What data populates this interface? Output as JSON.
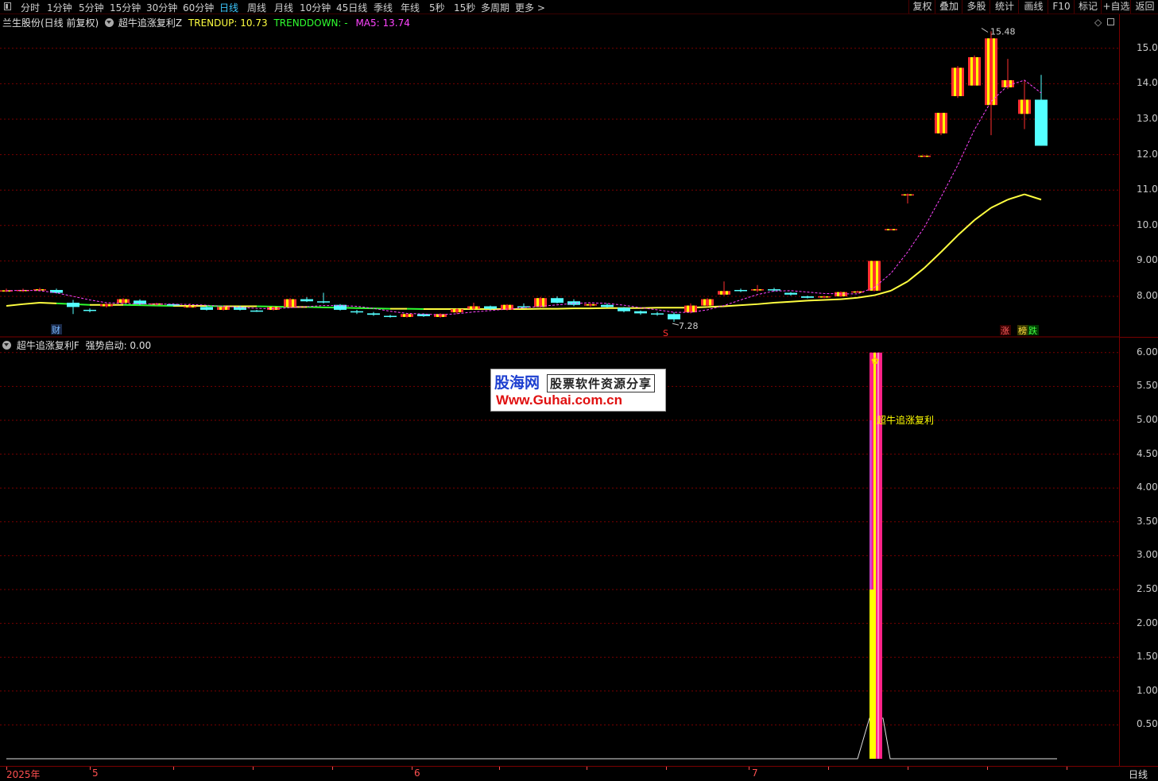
{
  "toolbar": {
    "periods": [
      "分时",
      "1分钟",
      "5分钟",
      "15分钟",
      "30分钟",
      "60分钟",
      "日线",
      "周线",
      "月线",
      "10分钟",
      "45日线",
      "季线",
      "年线",
      "5秒",
      "15秒",
      "多周期",
      "更多 >"
    ],
    "active_period": "日线",
    "buttons": [
      "复权",
      "叠加",
      "多股",
      "统计",
      "画线",
      "F10",
      "标记",
      "+自选",
      "返回"
    ]
  },
  "main_panel": {
    "stock": "兰生股份(日线 前复权)",
    "indicator": "超牛追涨复利Z",
    "trendup": "TRENDUP: 10.73",
    "trenddown": "TRENDDOWN: -",
    "ma5": "MA5: 13.74",
    "high_label": "15.48",
    "low_label": "7.28",
    "marks": {
      "cai": "财",
      "s": "S",
      "zhang": "涨",
      "bang": "榜",
      "die": "跌"
    }
  },
  "sub_panel": {
    "title": "超牛追涨复利F",
    "value": "强势启动: 0.00",
    "signal_label": "超牛追涨复利"
  },
  "watermark": {
    "name": "股海网",
    "tagline": "股票软件资源分享",
    "url": "Www.Guhai.com.cn"
  },
  "bottom": {
    "year": "2025年",
    "months": [
      "5",
      "6",
      "7"
    ],
    "period": "日线"
  },
  "colors": {
    "up": "#ff3030",
    "down": "#54ffff",
    "yellow": "#ffff00",
    "ma": "#ff44ff",
    "trend": "#ffff40",
    "trend2": "#30ff30",
    "grid": "#7a0000"
  },
  "chart_data": [
    {
      "type": "candlestick",
      "title": "兰生股份(日线 前复权)",
      "y_ticks": [
        8.0,
        9.0,
        10.0,
        11.0,
        12.0,
        13.0,
        14.0,
        15.0
      ],
      "ylim": [
        7.0,
        15.6
      ],
      "candles": [
        [
          8.15,
          8.22,
          8.12,
          8.17
        ],
        [
          8.15,
          8.22,
          8.12,
          8.18
        ],
        [
          8.18,
          8.24,
          8.14,
          8.2
        ],
        [
          8.18,
          8.22,
          8.08,
          8.1
        ],
        [
          7.82,
          7.9,
          7.5,
          7.7
        ],
        [
          7.62,
          7.66,
          7.55,
          7.6
        ],
        [
          7.72,
          7.8,
          7.68,
          7.78
        ],
        [
          7.82,
          7.95,
          7.78,
          7.92
        ],
        [
          7.88,
          7.92,
          7.76,
          7.78
        ],
        [
          7.78,
          7.82,
          7.74,
          7.8
        ],
        [
          7.78,
          7.8,
          7.72,
          7.74
        ],
        [
          7.72,
          7.8,
          7.68,
          7.72
        ],
        [
          7.7,
          7.74,
          7.6,
          7.62
        ],
        [
          7.62,
          7.72,
          7.6,
          7.7
        ],
        [
          7.7,
          7.74,
          7.6,
          7.62
        ],
        [
          7.6,
          7.62,
          7.56,
          7.58
        ],
        [
          7.62,
          7.72,
          7.6,
          7.7
        ],
        [
          7.7,
          7.95,
          7.68,
          7.92
        ],
        [
          7.92,
          7.98,
          7.84,
          7.86
        ],
        [
          7.86,
          8.1,
          7.8,
          7.84
        ],
        [
          7.76,
          7.78,
          7.6,
          7.62
        ],
        [
          7.58,
          7.62,
          7.5,
          7.55
        ],
        [
          7.52,
          7.56,
          7.45,
          7.48
        ],
        [
          7.45,
          7.48,
          7.4,
          7.42
        ],
        [
          7.42,
          7.52,
          7.4,
          7.5
        ],
        [
          7.5,
          7.52,
          7.42,
          7.44
        ],
        [
          7.42,
          7.52,
          7.4,
          7.5
        ],
        [
          7.55,
          7.66,
          7.5,
          7.64
        ],
        [
          7.65,
          7.82,
          7.62,
          7.72
        ],
        [
          7.72,
          7.74,
          7.62,
          7.65
        ],
        [
          7.62,
          7.78,
          7.6,
          7.76
        ],
        [
          7.72,
          7.8,
          7.66,
          7.7
        ],
        [
          7.7,
          7.98,
          7.68,
          7.95
        ],
        [
          7.95,
          8.0,
          7.8,
          7.82
        ],
        [
          7.86,
          7.92,
          7.72,
          7.76
        ],
        [
          7.74,
          7.8,
          7.7,
          7.78
        ],
        [
          7.76,
          7.8,
          7.68,
          7.7
        ],
        [
          7.68,
          7.7,
          7.55,
          7.58
        ],
        [
          7.58,
          7.6,
          7.48,
          7.52
        ],
        [
          7.52,
          7.56,
          7.45,
          7.5
        ],
        [
          7.5,
          7.55,
          7.28,
          7.35
        ],
        [
          7.55,
          7.8,
          7.52,
          7.74
        ],
        [
          7.74,
          7.95,
          7.7,
          7.92
        ],
        [
          8.05,
          8.42,
          8.02,
          8.15
        ],
        [
          8.18,
          8.22,
          8.12,
          8.16
        ],
        [
          8.18,
          8.32,
          8.12,
          8.2
        ],
        [
          8.2,
          8.24,
          8.14,
          8.18
        ],
        [
          8.1,
          8.12,
          8.02,
          8.05
        ],
        [
          8.0,
          8.02,
          7.94,
          7.96
        ],
        [
          7.98,
          8.02,
          7.95,
          8.0
        ],
        [
          8.0,
          8.14,
          7.98,
          8.12
        ],
        [
          8.12,
          8.16,
          8.1,
          8.14
        ],
        [
          8.16,
          9.0,
          8.14,
          9.0
        ],
        [
          9.9,
          9.9,
          9.9,
          9.9
        ],
        [
          10.85,
          10.9,
          10.62,
          10.88
        ],
        [
          11.96,
          11.98,
          11.96,
          11.97
        ],
        [
          12.6,
          13.18,
          12.55,
          13.18
        ],
        [
          13.65,
          14.5,
          13.6,
          14.45
        ],
        [
          13.95,
          14.8,
          13.95,
          14.75
        ],
        [
          13.4,
          15.48,
          12.55,
          15.28
        ],
        [
          13.9,
          14.7,
          13.85,
          14.1
        ],
        [
          13.15,
          14.1,
          12.72,
          13.55
        ],
        [
          13.55,
          14.25,
          12.25,
          12.25
        ]
      ],
      "ma5": [
        8.16,
        8.17,
        8.16,
        8.1,
        8.0,
        7.9,
        7.82,
        7.8,
        7.79,
        7.78,
        7.78,
        7.77,
        7.75,
        7.72,
        7.69,
        7.66,
        7.65,
        7.68,
        7.71,
        7.74,
        7.74,
        7.72,
        7.66,
        7.58,
        7.52,
        7.5,
        7.48,
        7.51,
        7.56,
        7.6,
        7.64,
        7.68,
        7.72,
        7.76,
        7.8,
        7.82,
        7.8,
        7.75,
        7.68,
        7.62,
        7.55,
        7.55,
        7.62,
        7.74,
        7.9,
        8.05,
        8.15,
        8.16,
        8.12,
        8.08,
        8.07,
        8.07,
        8.25,
        8.65,
        9.25,
        9.95,
        10.8,
        11.7,
        12.7,
        13.5,
        13.95,
        14.1,
        13.74
      ],
      "trend_line": [
        7.73,
        7.78,
        7.82,
        7.8,
        7.78,
        7.76,
        7.76,
        7.76,
        7.75,
        7.74,
        7.73,
        7.73,
        7.73,
        7.72,
        7.72,
        7.72,
        7.71,
        7.7,
        7.7,
        7.69,
        7.68,
        7.67,
        7.66,
        7.65,
        7.65,
        7.64,
        7.64,
        7.64,
        7.64,
        7.64,
        7.64,
        7.64,
        7.65,
        7.65,
        7.66,
        7.66,
        7.67,
        7.67,
        7.67,
        7.68,
        7.68,
        7.68,
        7.7,
        7.72,
        7.75,
        7.78,
        7.82,
        7.85,
        7.88,
        7.9,
        7.92,
        7.96,
        8.03,
        8.16,
        8.42,
        8.8,
        9.25,
        9.72,
        10.15,
        10.5,
        10.73,
        10.88,
        10.73
      ]
    },
    {
      "type": "bar",
      "title": "超牛追涨复利F",
      "y_ticks": [
        0.5,
        1.0,
        1.5,
        2.0,
        2.5,
        3.0,
        3.5,
        4.0,
        4.5,
        5.0,
        5.5,
        6.0
      ],
      "ylim": [
        0,
        6.2
      ],
      "signal_index": 52,
      "signal_value": 6.0,
      "line": [
        0.6,
        0.0
      ]
    }
  ]
}
